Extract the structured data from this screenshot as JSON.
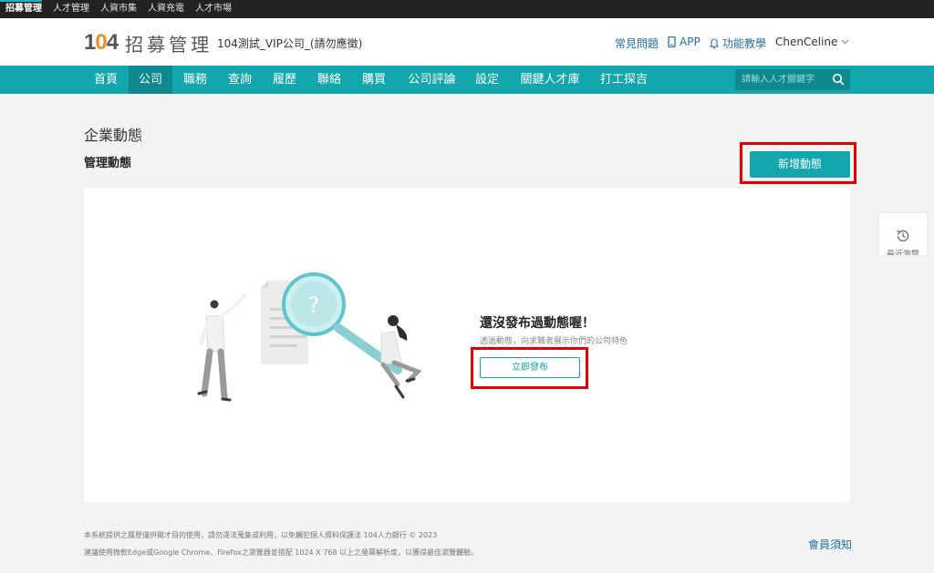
{
  "topbar": {
    "items": [
      {
        "label": "招募管理",
        "active": true
      },
      {
        "label": "人才管理",
        "active": false
      },
      {
        "label": "人資市集",
        "active": false
      },
      {
        "label": "人資充電",
        "active": false
      },
      {
        "label": "人才市場",
        "active": false
      }
    ]
  },
  "header": {
    "logo_number": "104",
    "logo_text": "招募管理",
    "company": "104測試_VIP公司_(請勿應徵)",
    "faq": "常見問題",
    "app": "APP",
    "tutorial": "功能教學",
    "user": "ChenCeline"
  },
  "nav": {
    "items": [
      {
        "label": "首頁",
        "active": false
      },
      {
        "label": "公司",
        "active": true
      },
      {
        "label": "職務",
        "active": false
      },
      {
        "label": "查詢",
        "active": false
      },
      {
        "label": "履歷",
        "active": false
      },
      {
        "label": "聯絡",
        "active": false
      },
      {
        "label": "購買",
        "active": false
      },
      {
        "label": "公司評論",
        "active": false
      },
      {
        "label": "設定",
        "active": false
      },
      {
        "label": "關鍵人才庫",
        "active": false
      },
      {
        "label": "打工探吉",
        "active": false
      }
    ],
    "search_placeholder": "請輸入人才關鍵字"
  },
  "page": {
    "title": "企業動態",
    "subtitle": "管理動態",
    "add_button": "新增動態"
  },
  "empty_state": {
    "title": "還沒發布過動態喔！",
    "description": "透過動態，向求職者展示你們的公司特色",
    "publish_button": "立即發布"
  },
  "side": {
    "recent_label": "最近瀏覽"
  },
  "footer": {
    "line1": "本系統提供之履歷僅供徵才目的使用，請勿違法蒐集或利用，以免觸犯個人資料保護法 104人力銀行 © 2023",
    "line2": "建議使用微軟Edge或Google Chrome、Firefox之瀏覽器並搭配 1024 X 768 以上之螢幕解析度，以獲得最佳瀏覽體驗。",
    "member_notice": "會員須知"
  },
  "colors": {
    "teal": "#14a6ad",
    "teal_dark": "#0f8990",
    "highlight_red": "#e40000",
    "link_blue": "#1b6fa8",
    "logo_orange": "#f28c28"
  }
}
